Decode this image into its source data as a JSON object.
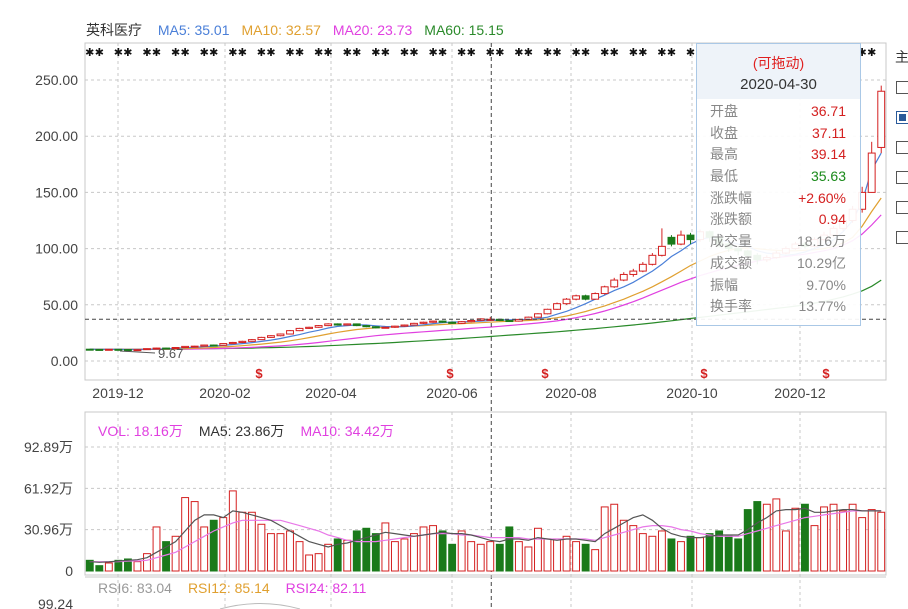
{
  "stock": {
    "name": "英科医疗"
  },
  "main_legend": [
    {
      "label": "MA5: 35.01",
      "color": "#4a7fd8"
    },
    {
      "label": "MA10: 32.57",
      "color": "#e0a030"
    },
    {
      "label": "MA20: 23.73",
      "color": "#e040e0"
    },
    {
      "label": "MA60: 15.15",
      "color": "#2a8a2a"
    }
  ],
  "vol_legend": [
    {
      "label": "VOL: 18.16万",
      "color": "#e040e0"
    },
    {
      "label": "MA5: 23.86万",
      "color": "#333333"
    },
    {
      "label": "MA10: 34.42万",
      "color": "#e040e0"
    }
  ],
  "rsi_legend": [
    {
      "label": "RSI6: 83.04",
      "color": "#999999"
    },
    {
      "label": "RSI12: 85.14",
      "color": "#e0a030"
    },
    {
      "label": "RSI24: 82.11",
      "color": "#e040e0"
    }
  ],
  "tooltip": {
    "drag_label": "(可拖动)",
    "date": "2020-04-30",
    "rows": [
      {
        "label": "开盘",
        "value": "36.71",
        "color": "#d42020"
      },
      {
        "label": "收盘",
        "value": "37.11",
        "color": "#d42020"
      },
      {
        "label": "最高",
        "value": "39.14",
        "color": "#d42020"
      },
      {
        "label": "最低",
        "value": "35.63",
        "color": "#1a8a1a"
      },
      {
        "label": "涨跌幅",
        "value": "+2.60%",
        "color": "#d42020"
      },
      {
        "label": "涨跌额",
        "value": "0.94",
        "color": "#d42020"
      },
      {
        "label": "成交量",
        "value": "18.16万",
        "color": "#888888"
      },
      {
        "label": "成交额",
        "value": "10.29亿",
        "color": "#888888"
      },
      {
        "label": "振幅",
        "value": "9.70%",
        "color": "#888888"
      },
      {
        "label": "换手率",
        "value": "13.77%",
        "color": "#888888"
      }
    ]
  },
  "right_panel": {
    "label": "主"
  },
  "colors": {
    "up": "#d42020",
    "down": "#1a7a1a",
    "grid": "#c8c8c8",
    "crosshair": "#444444"
  },
  "chart_data": [
    {
      "type": "candlestick",
      "x_tick_labels": [
        "2019-12",
        "2020-02",
        "2020-04",
        "2020-06",
        "2020-08",
        "2020-10",
        "2020-12"
      ],
      "y_tick_labels": [
        "250.00",
        "200.00",
        "150.00",
        "100.00",
        "50.00",
        "0.00"
      ],
      "ylim": [
        0,
        250
      ],
      "min_marker": "9.67",
      "crosshair": {
        "date": "2020-04-30",
        "price": 37.11
      },
      "candles": [
        [
          10.5,
          10.3,
          10.7,
          10.0
        ],
        [
          10.3,
          10.2,
          10.5,
          9.9
        ],
        [
          10.2,
          10.4,
          10.6,
          9.9
        ],
        [
          10.4,
          10.2,
          10.5,
          9.8
        ],
        [
          10.2,
          10.0,
          10.4,
          9.7
        ],
        [
          10.0,
          10.1,
          10.3,
          9.7
        ],
        [
          10.1,
          11.0,
          11.2,
          10.0
        ],
        [
          11.0,
          11.5,
          11.8,
          10.8
        ],
        [
          11.5,
          11.3,
          11.9,
          11.0
        ],
        [
          11.3,
          12.0,
          12.2,
          11.1
        ],
        [
          12.0,
          13.0,
          13.3,
          11.8
        ],
        [
          13.0,
          13.2,
          13.5,
          12.7
        ],
        [
          13.2,
          14.2,
          14.5,
          13.0
        ],
        [
          14.2,
          14.0,
          14.7,
          13.6
        ],
        [
          14.0,
          15.5,
          15.8,
          13.9
        ],
        [
          15.5,
          16.5,
          17.0,
          15.2
        ],
        [
          16.5,
          17.5,
          18.0,
          16.2
        ],
        [
          17.5,
          19.0,
          19.6,
          17.2
        ],
        [
          19.0,
          21.0,
          21.5,
          18.7
        ],
        [
          21.0,
          22.5,
          23.0,
          20.5
        ],
        [
          22.5,
          24.0,
          24.5,
          22.0
        ],
        [
          24.0,
          27.0,
          27.6,
          23.8
        ],
        [
          27.0,
          29.0,
          29.5,
          26.6
        ],
        [
          29.0,
          30.0,
          30.5,
          28.5
        ],
        [
          30.0,
          31.5,
          32.0,
          29.6
        ],
        [
          31.5,
          33.0,
          33.6,
          31.0
        ],
        [
          33.0,
          32.0,
          33.5,
          31.5
        ],
        [
          32.0,
          33.0,
          33.4,
          31.5
        ],
        [
          33.0,
          31.5,
          33.4,
          31.0
        ],
        [
          31.5,
          30.5,
          31.8,
          30.0
        ],
        [
          30.5,
          29.5,
          31.0,
          29.0
        ],
        [
          29.5,
          30.0,
          30.4,
          29.0
        ],
        [
          30.0,
          31.0,
          31.4,
          29.5
        ],
        [
          31.0,
          32.0,
          32.5,
          30.5
        ],
        [
          32.0,
          33.5,
          34.0,
          31.5
        ],
        [
          33.5,
          34.5,
          35.0,
          33.0
        ],
        [
          34.5,
          35.5,
          36.0,
          34.0
        ],
        [
          35.5,
          34.5,
          36.0,
          34.0
        ],
        [
          34.5,
          33.5,
          35.0,
          33.0
        ],
        [
          33.5,
          35.0,
          35.5,
          33.0
        ],
        [
          35.0,
          36.0,
          36.5,
          34.5
        ],
        [
          36.2,
          37.5,
          38.0,
          35.8
        ],
        [
          36.71,
          37.11,
          39.14,
          35.63
        ],
        [
          37.1,
          36.0,
          37.5,
          35.5
        ],
        [
          36.0,
          35.5,
          36.5,
          35.0
        ],
        [
          35.5,
          37.0,
          37.5,
          35.0
        ],
        [
          37.0,
          39.0,
          39.5,
          36.5
        ],
        [
          39.0,
          42.0,
          42.5,
          38.5
        ],
        [
          42.0,
          46.0,
          46.5,
          41.5
        ],
        [
          46.0,
          51.0,
          52.0,
          45.5
        ],
        [
          51.0,
          55.0,
          56.0,
          50.0
        ],
        [
          55.0,
          58.0,
          59.0,
          54.0
        ],
        [
          58.0,
          55.0,
          59.0,
          54.0
        ],
        [
          55.0,
          60.0,
          61.0,
          54.5
        ],
        [
          60.0,
          66.0,
          67.0,
          59.0
        ],
        [
          66.0,
          72.0,
          74.0,
          65.0
        ],
        [
          72.0,
          77.0,
          79.0,
          71.0
        ],
        [
          77.0,
          80.0,
          82.0,
          75.0
        ],
        [
          80.0,
          86.0,
          88.0,
          79.0
        ],
        [
          86.0,
          94.0,
          96.0,
          85.0
        ],
        [
          94.0,
          102.0,
          118.0,
          93.0
        ],
        [
          110.0,
          104.0,
          112.0,
          102.0
        ],
        [
          104.0,
          112.0,
          116.0,
          103.0
        ],
        [
          112.0,
          108.0,
          114.0,
          104.0
        ],
        [
          108.0,
          115.0,
          117.0,
          106.0
        ],
        [
          115.0,
          110.0,
          116.0,
          106.0
        ],
        [
          110.0,
          104.0,
          111.0,
          101.0
        ],
        [
          104.0,
          100.0,
          106.0,
          97.0
        ],
        [
          100.0,
          98.0,
          102.0,
          94.0
        ],
        [
          98.0,
          94.0,
          99.0,
          90.0
        ],
        [
          94.0,
          90.0,
          96.0,
          86.0
        ],
        [
          90.0,
          92.0,
          94.0,
          88.0
        ],
        [
          92.0,
          96.0,
          98.0,
          91.0
        ],
        [
          96.0,
          100.0,
          102.0,
          95.0
        ],
        [
          100.0,
          104.0,
          106.0,
          99.0
        ],
        [
          104.0,
          102.0,
          106.0,
          100.0
        ],
        [
          102.0,
          108.0,
          110.0,
          101.0
        ],
        [
          108.0,
          112.0,
          115.0,
          107.0
        ],
        [
          112.0,
          118.0,
          120.0,
          110.0
        ],
        [
          118.0,
          125.0,
          128.0,
          116.0
        ],
        [
          125.0,
          135.0,
          138.0,
          123.0
        ],
        [
          135.0,
          150.0,
          155.0,
          132.0
        ],
        [
          150.0,
          185.0,
          195.0,
          160.0
        ],
        [
          190.0,
          240.0,
          245.0,
          185.0
        ]
      ],
      "ma5": [
        10.5,
        10.4,
        10.3,
        10.3,
        10.2,
        10.2,
        10.3,
        10.6,
        10.8,
        11.4,
        11.8,
        12.2,
        12.7,
        13.3,
        13.9,
        14.7,
        15.5,
        16.4,
        17.4,
        18.6,
        20.0,
        21.8,
        23.5,
        25.6,
        27.3,
        29.4,
        30.8,
        31.5,
        32.1,
        32.0,
        31.3,
        30.7,
        30.4,
        30.5,
        31.2,
        32.2,
        33.3,
        34.1,
        34.7,
        34.7,
        35.1,
        35.5,
        36.0,
        36.5,
        36.6,
        36.7,
        37.0,
        37.7,
        39.0,
        41.6,
        44.2,
        47.4,
        51.0,
        55.0,
        58.6,
        62.6,
        66.0,
        70.0,
        75.0,
        80.0,
        86.0,
        93.0,
        98.0,
        104.0,
        108.0,
        110.0,
        108.0,
        106.0,
        104.0,
        102.0,
        98.0,
        96.0,
        95.0,
        94.0,
        95.0,
        97.0,
        100.0,
        103.0,
        108.0,
        115.0,
        125.0,
        142.0,
        170.0,
        185.0
      ],
      "ma10": [
        10.5,
        10.5,
        10.4,
        10.4,
        10.3,
        10.3,
        10.3,
        10.4,
        10.5,
        10.8,
        11.0,
        11.3,
        11.6,
        12.0,
        12.5,
        13.0,
        13.6,
        14.3,
        15.0,
        15.9,
        16.8,
        18.0,
        19.3,
        20.8,
        22.3,
        24.0,
        25.5,
        26.8,
        28.0,
        28.8,
        29.5,
        30.0,
        30.4,
        30.8,
        31.1,
        31.5,
        32.0,
        32.5,
        33.0,
        33.3,
        33.7,
        34.1,
        34.5,
        35.0,
        35.3,
        35.7,
        36.0,
        36.6,
        37.4,
        38.5,
        40.0,
        42.0,
        44.0,
        46.5,
        49.0,
        52.0,
        55.0,
        58.5,
        62.0,
        66.0,
        70.5,
        75.0,
        80.0,
        85.0,
        89.0,
        93.0,
        96.0,
        98.5,
        100.0,
        100.5,
        100.0,
        99.0,
        98.5,
        98.0,
        98.0,
        98.5,
        99.0,
        100.0,
        102.0,
        105.0,
        110.0,
        120.0,
        133.0,
        145.0
      ],
      "ma20": [
        10.5,
        10.5,
        10.5,
        10.5,
        10.4,
        10.4,
        10.4,
        10.4,
        10.4,
        10.5,
        10.6,
        10.7,
        10.8,
        11.0,
        11.2,
        11.5,
        11.8,
        12.1,
        12.5,
        13.0,
        13.5,
        14.1,
        14.8,
        15.6,
        16.5,
        17.5,
        18.5,
        19.5,
        20.5,
        21.5,
        22.5,
        23.3,
        24.0,
        24.7,
        25.4,
        26.0,
        26.6,
        27.2,
        27.8,
        28.4,
        29.0,
        29.6,
        30.2,
        30.9,
        31.6,
        32.3,
        33.0,
        33.8,
        34.7,
        35.7,
        37.0,
        38.5,
        40.3,
        42.3,
        44.5,
        47.0,
        49.8,
        52.8,
        56.0,
        59.5,
        63.0,
        66.5,
        70.0,
        73.0,
        76.0,
        78.5,
        81.0,
        83.0,
        85.0,
        87.0,
        89.0,
        90.5,
        92.0,
        93.0,
        94.0,
        95.0,
        96.5,
        98.0,
        100.0,
        103.0,
        107.0,
        113.0,
        121.0,
        130.0
      ],
      "ma60": [
        10.3,
        10.3,
        10.4,
        10.4,
        10.4,
        10.5,
        10.5,
        10.5,
        10.6,
        10.6,
        10.7,
        10.8,
        10.9,
        11.0,
        11.1,
        11.2,
        11.3,
        11.5,
        11.7,
        11.9,
        12.1,
        12.3,
        12.6,
        12.9,
        13.2,
        13.6,
        14.0,
        14.4,
        14.8,
        15.2,
        15.6,
        16.0,
        16.5,
        17.0,
        17.5,
        18.0,
        18.5,
        19.0,
        19.5,
        20.0,
        20.6,
        21.2,
        21.8,
        22.4,
        23.0,
        23.6,
        24.2,
        24.8,
        25.4,
        26.0,
        26.7,
        27.4,
        28.1,
        28.8,
        29.6,
        30.4,
        31.2,
        32.0,
        32.9,
        33.8,
        34.8,
        35.8,
        36.8,
        37.8,
        38.8,
        39.8,
        40.8,
        41.8,
        42.8,
        43.8,
        44.8,
        45.8,
        46.8,
        47.8,
        48.8,
        50.0,
        51.5,
        53.0,
        55.0,
        57.0,
        59.5,
        62.5,
        66.5,
        72.0
      ]
    },
    {
      "type": "bar",
      "y_tick_labels": [
        "92.89万",
        "61.92万",
        "30.96万",
        "0"
      ],
      "ylim": [
        0,
        92.89
      ],
      "volumes": [
        8,
        4,
        6,
        8,
        9,
        7,
        13,
        33,
        22,
        26,
        55,
        52,
        33,
        38,
        40,
        60,
        44,
        44,
        35,
        28,
        28,
        30,
        22,
        12,
        13,
        20,
        24,
        23,
        30,
        32,
        28,
        36,
        22,
        24,
        28,
        33,
        34,
        30,
        20,
        30,
        22,
        20,
        22,
        20,
        33,
        22,
        18,
        32,
        24,
        24,
        26,
        22,
        20,
        16,
        48,
        50,
        38,
        34,
        28,
        26,
        30,
        24,
        22,
        26,
        25,
        28,
        30,
        26,
        24,
        46,
        52,
        50,
        54,
        30,
        47,
        50,
        34,
        48,
        50,
        45,
        50,
        40,
        46,
        44
      ],
      "vol_ma5": [
        7,
        6.5,
        6.8,
        7.5,
        8,
        8.5,
        10,
        14,
        18,
        22,
        30,
        38,
        42,
        42,
        40,
        45,
        44,
        42,
        40,
        38,
        34,
        30,
        26,
        22,
        20,
        18,
        20,
        21,
        23,
        25,
        27,
        29,
        28,
        27,
        26,
        27,
        28,
        29,
        28,
        28,
        27,
        25,
        23,
        22,
        24,
        24,
        23,
        25,
        24,
        23,
        24,
        24,
        23,
        22,
        28,
        32,
        36,
        40,
        42,
        38,
        32,
        28,
        26,
        25,
        25,
        26,
        27,
        27,
        27,
        31,
        36,
        40,
        45,
        46,
        46,
        47,
        44,
        44,
        45,
        46,
        46,
        45,
        45,
        45
      ],
      "vol_ma10": [
        7,
        7,
        7,
        7,
        7.5,
        7.5,
        8,
        10,
        12,
        14,
        18,
        22,
        26,
        30,
        33,
        36,
        38,
        38,
        38,
        38,
        38,
        36,
        34,
        32,
        30,
        27,
        25,
        23,
        22,
        22,
        22,
        23,
        24,
        25,
        26,
        27,
        28,
        28,
        28,
        27,
        27,
        26,
        25,
        25,
        25,
        25,
        24,
        24,
        24,
        24,
        24,
        24,
        24,
        23,
        25,
        27,
        29,
        31,
        33,
        34,
        34,
        33,
        31,
        30,
        28,
        27,
        26,
        26,
        26,
        28,
        30,
        32,
        34,
        36,
        38,
        40,
        41,
        42,
        43,
        44,
        45,
        45,
        45,
        45
      ]
    },
    {
      "type": "line",
      "ytick_labels": [
        "99.24"
      ]
    }
  ]
}
